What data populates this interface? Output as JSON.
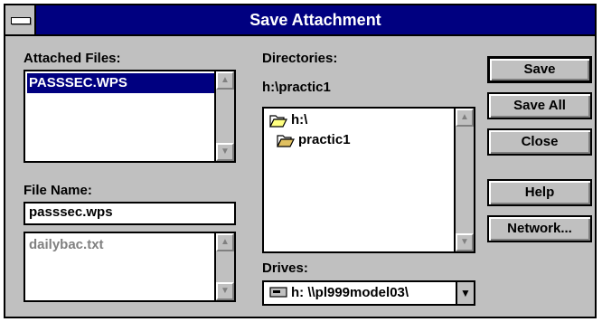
{
  "window": {
    "title": "Save Attachment"
  },
  "attached_files": {
    "label": "Attached Files:",
    "items": [
      "PASSSEC.WPS"
    ]
  },
  "file_name": {
    "label": "File Name:",
    "value": "passsec.wps",
    "list_items": [
      "dailybac.txt"
    ]
  },
  "directories": {
    "label": "Directories:",
    "current_path": "h:\\practic1",
    "tree": [
      "h:\\",
      "practic1"
    ]
  },
  "drives": {
    "label": "Drives:",
    "selected": "h: \\\\pl999model03\\"
  },
  "buttons": {
    "save": "Save",
    "save_all": "Save All",
    "close": "Close",
    "help": "Help",
    "network": "Network..."
  },
  "icons": {
    "system_menu": "system-menu-icon",
    "scroll_up": "scroll-up-arrow-icon",
    "scroll_down": "scroll-down-arrow-icon",
    "folder_open": "folder-open-icon",
    "folder": "folder-icon",
    "drive": "network-drive-icon",
    "dropdown": "dropdown-arrow-icon"
  },
  "colors": {
    "titlebar": "#000080",
    "selection": "#000080",
    "dialog": "#c0c0c0"
  }
}
